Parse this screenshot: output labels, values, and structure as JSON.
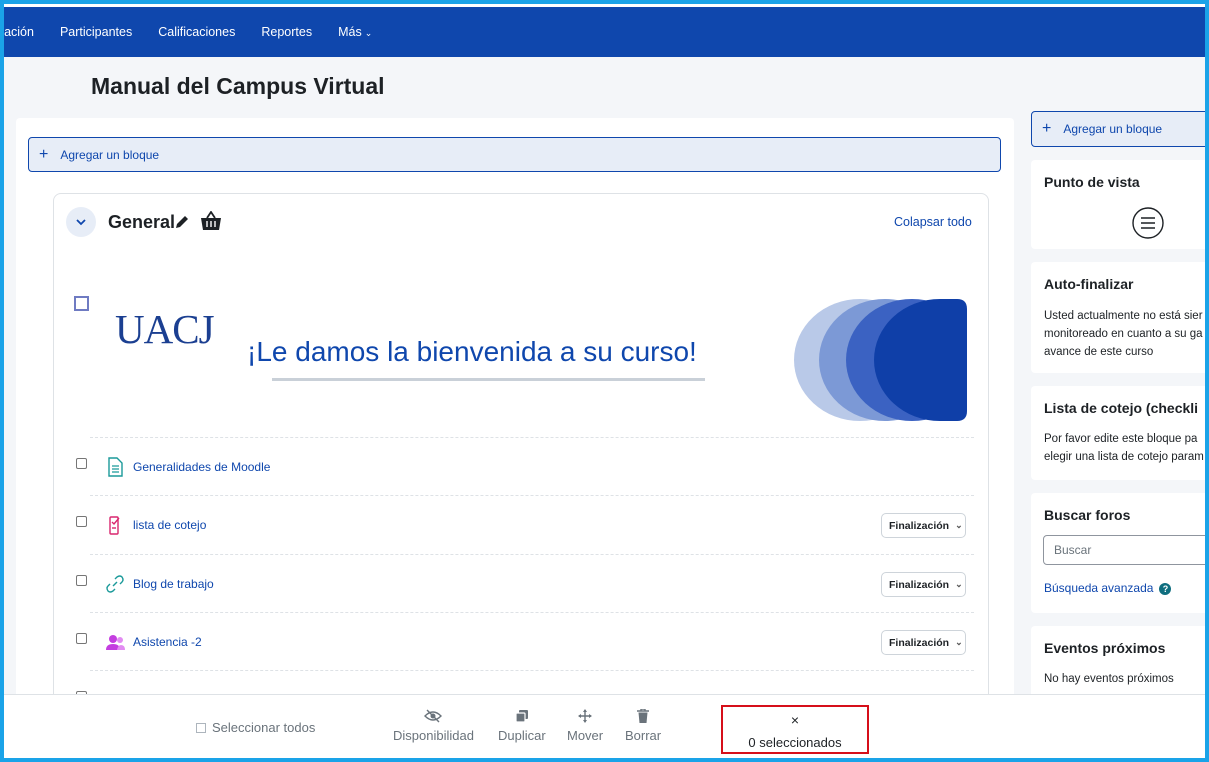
{
  "nav": {
    "items": [
      "guración",
      "Participantes",
      "Calificaciones",
      "Reportes",
      "Más"
    ]
  },
  "page": {
    "title": "Manual del Campus Virtual",
    "add_block": "Agregar un bloque"
  },
  "section": {
    "name": "General",
    "collapse_all": "Colapsar todo",
    "banner": {
      "logo": "UACJ",
      "welcome": "¡Le damos la bienvenida a su curso!"
    },
    "activities": [
      {
        "name": "Generalidades de Moodle",
        "icon": "page-icon",
        "completion": ""
      },
      {
        "name": "lista de cotejo",
        "icon": "checklist-icon",
        "completion": "Finalización"
      },
      {
        "name": "Blog de trabajo",
        "icon": "url-link-icon",
        "completion": "Finalización"
      },
      {
        "name": "Asistencia -2",
        "icon": "attendance-icon",
        "completion": "Finalización"
      }
    ]
  },
  "drawer": {
    "add_block": "Agregar un bloque",
    "punto_de_vista": {
      "title": "Punto de vista"
    },
    "auto_finalizar": {
      "title": "Auto-finalizar",
      "lines": [
        "Usted actualmente no está sier",
        "monitoreado en cuanto a su ga",
        "avance de este curso"
      ]
    },
    "checklist": {
      "title": "Lista de cotejo (checkli",
      "lines": [
        "Por favor edite este bloque pa",
        "elegir una lista de cotejo param"
      ]
    },
    "buscar_foros": {
      "title": "Buscar foros",
      "placeholder": "Buscar",
      "advanced": "Búsqueda avanzada"
    },
    "eventos": {
      "title": "Eventos próximos",
      "lines": [
        "No hay eventos próximos"
      ]
    }
  },
  "bulk": {
    "select_all": "Seleccionar todos",
    "availability": "Disponibilidad",
    "duplicate": "Duplicar",
    "move": "Mover",
    "delete": "Borrar",
    "close": "×",
    "selected_count": "0 seleccionados"
  },
  "colors": {
    "nav_bg": "#0f47ad",
    "link": "#0f47ad",
    "highlight_border": "#d60f1a",
    "frame_border": "#1aa3e8"
  }
}
